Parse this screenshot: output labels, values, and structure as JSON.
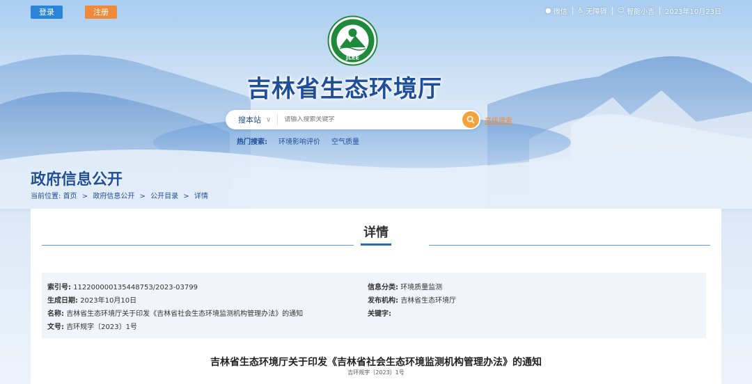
{
  "topbar": {
    "login_label": "登录",
    "register_label": "注册",
    "wechat_label": "微信",
    "accessibility_label": "无障碍",
    "assistant_label": "智能小吉",
    "date": "2023年10月23日"
  },
  "header": {
    "logo_text": "JLEE",
    "site_title": "吉林省生态环境厅"
  },
  "search": {
    "scope": "搜本站",
    "placeholder": "请输入搜索关键字",
    "advanced_label": "高级搜索",
    "hot_label": "热门搜索:",
    "hot_terms": [
      "环境影响评价",
      "空气质量"
    ]
  },
  "section": {
    "title": "政府信息公开",
    "breadcrumb_prefix": "当前位置:",
    "breadcrumb": [
      "首页",
      "政府信息公开",
      "公开目录",
      "详情"
    ]
  },
  "detail": {
    "heading": "详情",
    "meta": {
      "index_key": "索引号:",
      "index_value": "11220000013544875З/2023-03799",
      "date_key": "生成日期:",
      "date_value": "2023年10月10日",
      "name_key": "名称:",
      "name_value": "吉林省生态环境厅关于印发《吉林省社会生态环境监测机构管理办法》的通知",
      "docno_key": "文号:",
      "docno_value": "吉环规字〔2023〕1号",
      "category_key": "信息分类:",
      "category_value": "环境质量监测",
      "publisher_key": "发布机构:",
      "publisher_value": "吉林省生态环境厅",
      "keywords_key": "关键字:",
      "keywords_value": ""
    },
    "doc_title": "吉林省生态环境厅关于印发《吉林省社会生态环境监测机构管理办法》的通知",
    "doc_number": "吉环规字〔2023〕1号"
  },
  "colors": {
    "primary_blue": "#1f4f9a",
    "login_blue": "#2b84d8",
    "register_orange": "#ef8a3a",
    "logo_green": "#1f8a3c"
  }
}
